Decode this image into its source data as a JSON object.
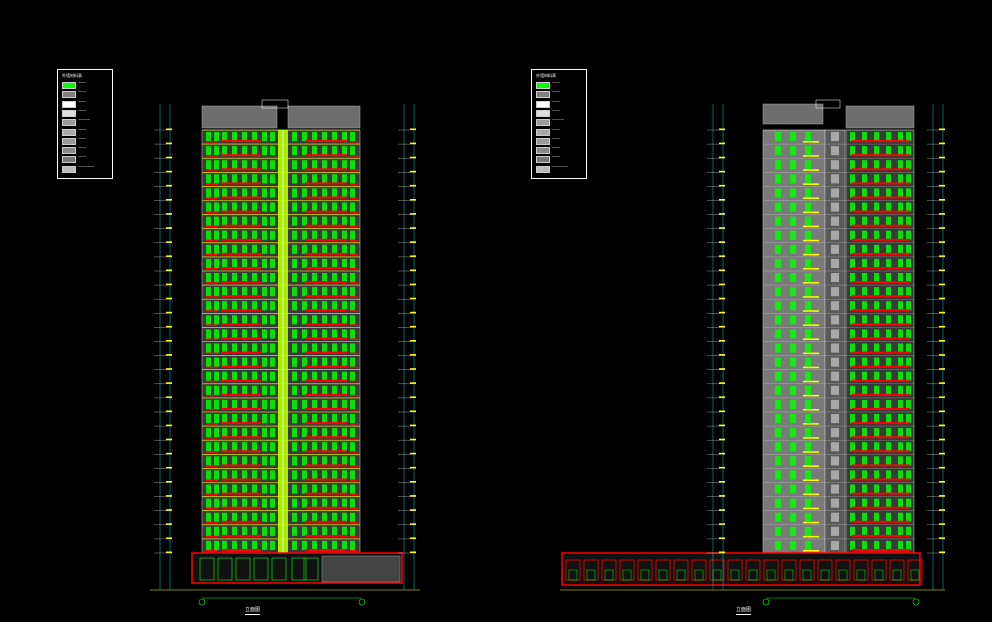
{
  "legend_left": {
    "head": "外墙材料表",
    "items": [
      {
        "color": "#00ff00",
        "label": "——"
      },
      {
        "color": "#808080",
        "label": "——"
      },
      {
        "color": "#ffffff",
        "label": "——"
      },
      {
        "color": "#dddddd",
        "label": "——"
      },
      {
        "color": "#9a9a9a",
        "label": "———"
      },
      {
        "color": "#aaaaaa",
        "label": "——"
      },
      {
        "color": "#999999",
        "label": "——"
      },
      {
        "color": "#888888",
        "label": "——"
      },
      {
        "color": "#777777",
        "label": "——"
      },
      {
        "color": "#bbbbbb",
        "label": "————"
      }
    ]
  },
  "legend_right": {
    "head": "外墙材料表",
    "items": [
      {
        "color": "#00ff00",
        "label": "——"
      },
      {
        "color": "#808080",
        "label": "——"
      },
      {
        "color": "#ffffff",
        "label": "——"
      },
      {
        "color": "#dddddd",
        "label": "——"
      },
      {
        "color": "#9a9a9a",
        "label": "———"
      },
      {
        "color": "#aaaaaa",
        "label": "——"
      },
      {
        "color": "#999999",
        "label": "——"
      },
      {
        "color": "#888888",
        "label": "——"
      },
      {
        "color": "#777777",
        "label": "——"
      },
      {
        "color": "#bbbbbb",
        "label": "————"
      }
    ]
  },
  "elevations": [
    {
      "caption": "立面图",
      "floors": 30
    },
    {
      "caption": "立面图",
      "floors": 30
    }
  ],
  "colors": {
    "background": "#000000",
    "window": "#00ff00",
    "balcony": "#ff0000",
    "trim": "#ffff00",
    "wall": "#8c8c8c",
    "dimension": "#00ffff"
  }
}
